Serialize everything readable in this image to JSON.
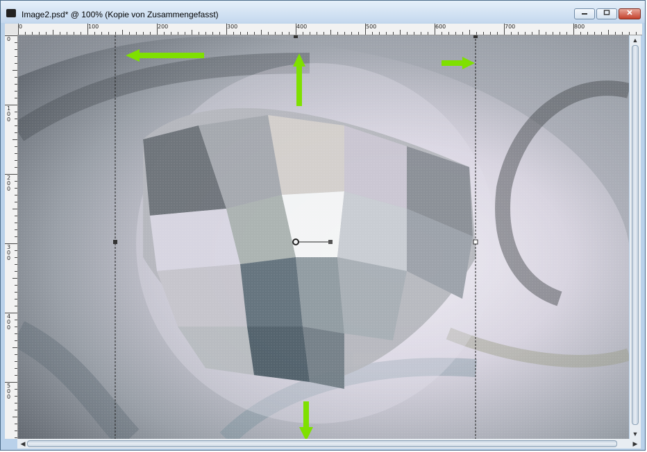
{
  "window": {
    "title": "Image2.psd* @ 100% (Kopie von Zusammengefasst)",
    "icon": "app-document-icon",
    "controls": [
      "minimize-icon",
      "restore-icon",
      "close-icon"
    ]
  },
  "ruler": {
    "horizontal_labels": [
      "0",
      "100",
      "200",
      "300",
      "400",
      "500",
      "600",
      "700",
      "800"
    ],
    "vertical_labels": [
      "0",
      "100",
      "200",
      "300",
      "400",
      "500"
    ]
  },
  "canvas": {
    "content": "swirl-image-with-warped-mosaic",
    "arrow_color": "#7fe000",
    "guide_color": "#222222",
    "arrows": [
      "arrow-left",
      "arrow-up",
      "arrow-right",
      "arrow-down"
    ]
  },
  "colors": {
    "title_bar": "#c4d8ee",
    "window_frame": "#b9d1ea",
    "close_button": "#c4412c"
  }
}
